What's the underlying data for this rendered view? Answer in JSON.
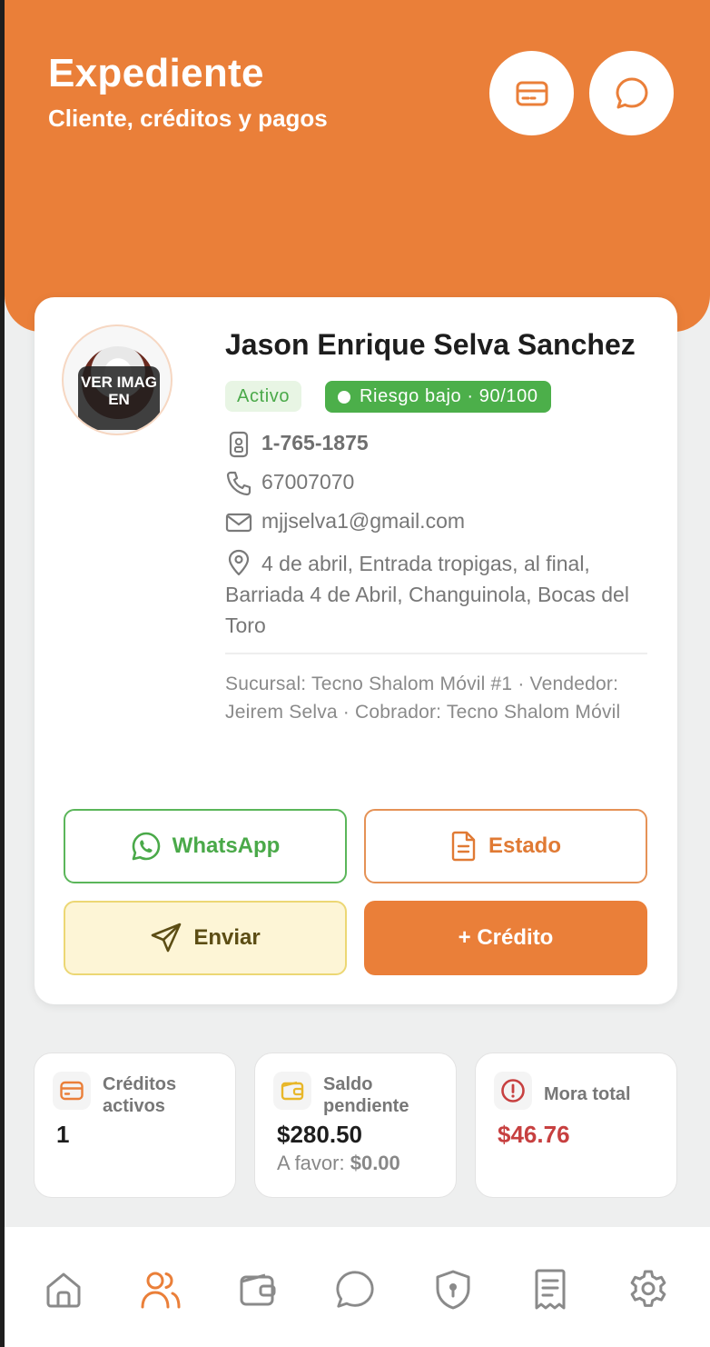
{
  "header": {
    "title": "Expediente",
    "subtitle": "Cliente, créditos y pagos",
    "icons": [
      "credit-card-icon",
      "chat-bubble-icon"
    ]
  },
  "client": {
    "avatar_overlay": "VER IMAGEN",
    "name": "Jason Enrique Selva Sanchez",
    "status": "Activo",
    "risk": "Riesgo bajo · 90/100",
    "cedula": "1-765-1875",
    "phone": "67007070",
    "email": "mjjselva1@gmail.com",
    "address": "4 de abril, Entrada tropigas, al final, Barriada 4 de Abril, Changuinola, Bocas del Toro",
    "meta": "Sucursal: Tecno Shalom Móvil #1 · Vendedor: Jeirem Selva · Cobrador: Tecno Shalom Móvil"
  },
  "actions": {
    "whatsapp": "WhatsApp",
    "estado": "Estado",
    "enviar": "Enviar",
    "credito": "+ Crédito"
  },
  "stats": [
    {
      "label": "Créditos activos",
      "value": "1",
      "icon": "credit-card-icon"
    },
    {
      "label": "Saldo pendiente",
      "value": "$280.50",
      "sub_label": "A favor:",
      "sub_value": "$0.00",
      "icon": "wallet-icon"
    },
    {
      "label": "Mora total",
      "value": "$46.76",
      "icon": "alert-circle-icon"
    }
  ],
  "nav": [
    "home-icon",
    "users-icon",
    "wallet-icon",
    "chat-icon",
    "shield-icon",
    "receipt-icon",
    "settings-icon"
  ],
  "colors": {
    "accent": "#ea7f39",
    "success": "#4caf4a",
    "danger": "#c74040",
    "warning_bg": "#fdf5d6"
  }
}
